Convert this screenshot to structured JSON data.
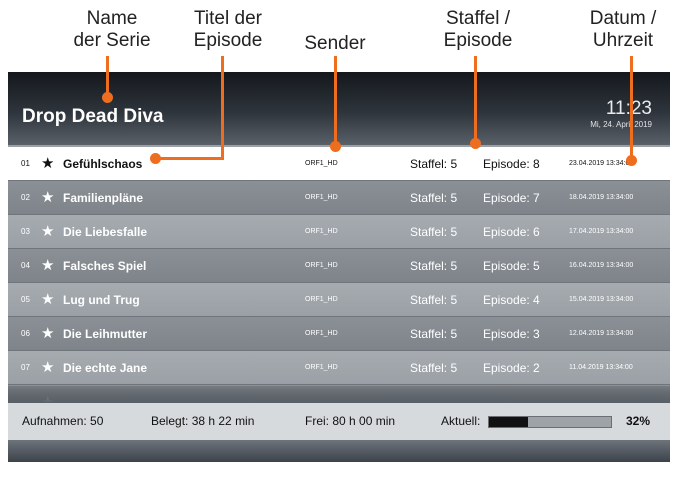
{
  "annotations": {
    "series_name": [
      "Name",
      "der Serie"
    ],
    "episode_title": [
      "Titel der",
      "Episode"
    ],
    "channel": [
      "Sender"
    ],
    "season_episode": [
      "Staffel /",
      "Episode"
    ],
    "date_time": [
      "Datum /",
      "Uhrzeit"
    ]
  },
  "header": {
    "series_title": "Drop Dead Diva",
    "time": "11:23",
    "date": "Mi, 24. April 2019"
  },
  "episodes": [
    {
      "num": "01",
      "title": "Gefühlschaos",
      "channel": "ORF1_HD",
      "season": "Staffel: 5",
      "episode": "Episode: 8",
      "datetime": "23.04.2019 13:34:00"
    },
    {
      "num": "02",
      "title": "Familienpläne",
      "channel": "ORF1_HD",
      "season": "Staffel: 5",
      "episode": "Episode: 7",
      "datetime": "18.04.2019 13:34:00"
    },
    {
      "num": "03",
      "title": "Die Liebesfalle",
      "channel": "ORF1_HD",
      "season": "Staffel: 5",
      "episode": "Episode: 6",
      "datetime": "17.04.2019 13:34:00"
    },
    {
      "num": "04",
      "title": "Falsches Spiel",
      "channel": "ORF1_HD",
      "season": "Staffel: 5",
      "episode": "Episode: 5",
      "datetime": "16.04.2019 13:34:00"
    },
    {
      "num": "05",
      "title": "Lug und Trug",
      "channel": "ORF1_HD",
      "season": "Staffel: 5",
      "episode": "Episode: 4",
      "datetime": "15.04.2019 13:34:00"
    },
    {
      "num": "06",
      "title": "Die Leihmutter",
      "channel": "ORF1_HD",
      "season": "Staffel: 5",
      "episode": "Episode: 3",
      "datetime": "12.04.2019 13:34:00"
    },
    {
      "num": "07",
      "title": "Die echte Jane",
      "channel": "ORF1_HD",
      "season": "Staffel: 5",
      "episode": "Episode: 2",
      "datetime": "11.04.2019 13:34:00"
    }
  ],
  "status": {
    "recordings": "Aufnahmen: 50",
    "used": "Belegt: 38 h 22 min",
    "free": "Frei: 80 h 00 min",
    "current_label": "Aktuell:",
    "current_fraction": 0.32,
    "current_percent": "32%"
  },
  "colors": {
    "accent": "#ee6d1f",
    "row_dark": "#8a9096",
    "row_light": "#a6abb0",
    "selected_row": "#ffffff"
  },
  "icons": {
    "favorite": "star-icon"
  }
}
